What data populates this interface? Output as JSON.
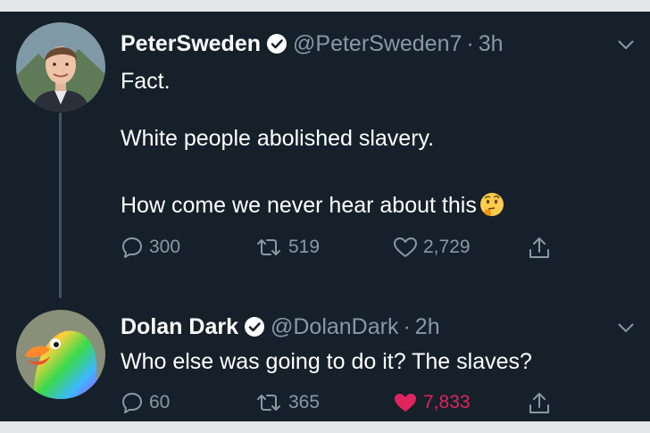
{
  "tweets": [
    {
      "name": "PeterSweden",
      "handle": "@PeterSweden7",
      "time": "3h",
      "lines": [
        "Fact.",
        "White people abolished slavery.",
        "How come we never hear about this"
      ],
      "emoji": "thinking-face",
      "replies": "300",
      "retweets": "519",
      "likes": "2,729",
      "liked": false
    },
    {
      "name": "Dolan Dark",
      "handle": "@DolanDark",
      "time": "2h",
      "lines": [
        "Who else was going to do it? The slaves?"
      ],
      "replies": "60",
      "retweets": "365",
      "likes": "7,833",
      "liked": true
    }
  ],
  "colors": {
    "background": "#15202b",
    "text": "#ffffff",
    "muted": "#8899a6",
    "like": "#e0245e",
    "thread_line": "#3d5466"
  },
  "icons": [
    "verified-badge-icon",
    "chevron-down-icon",
    "reply-icon",
    "retweet-icon",
    "like-icon",
    "share-icon",
    "thinking-face-emoji"
  ],
  "separator": "·"
}
